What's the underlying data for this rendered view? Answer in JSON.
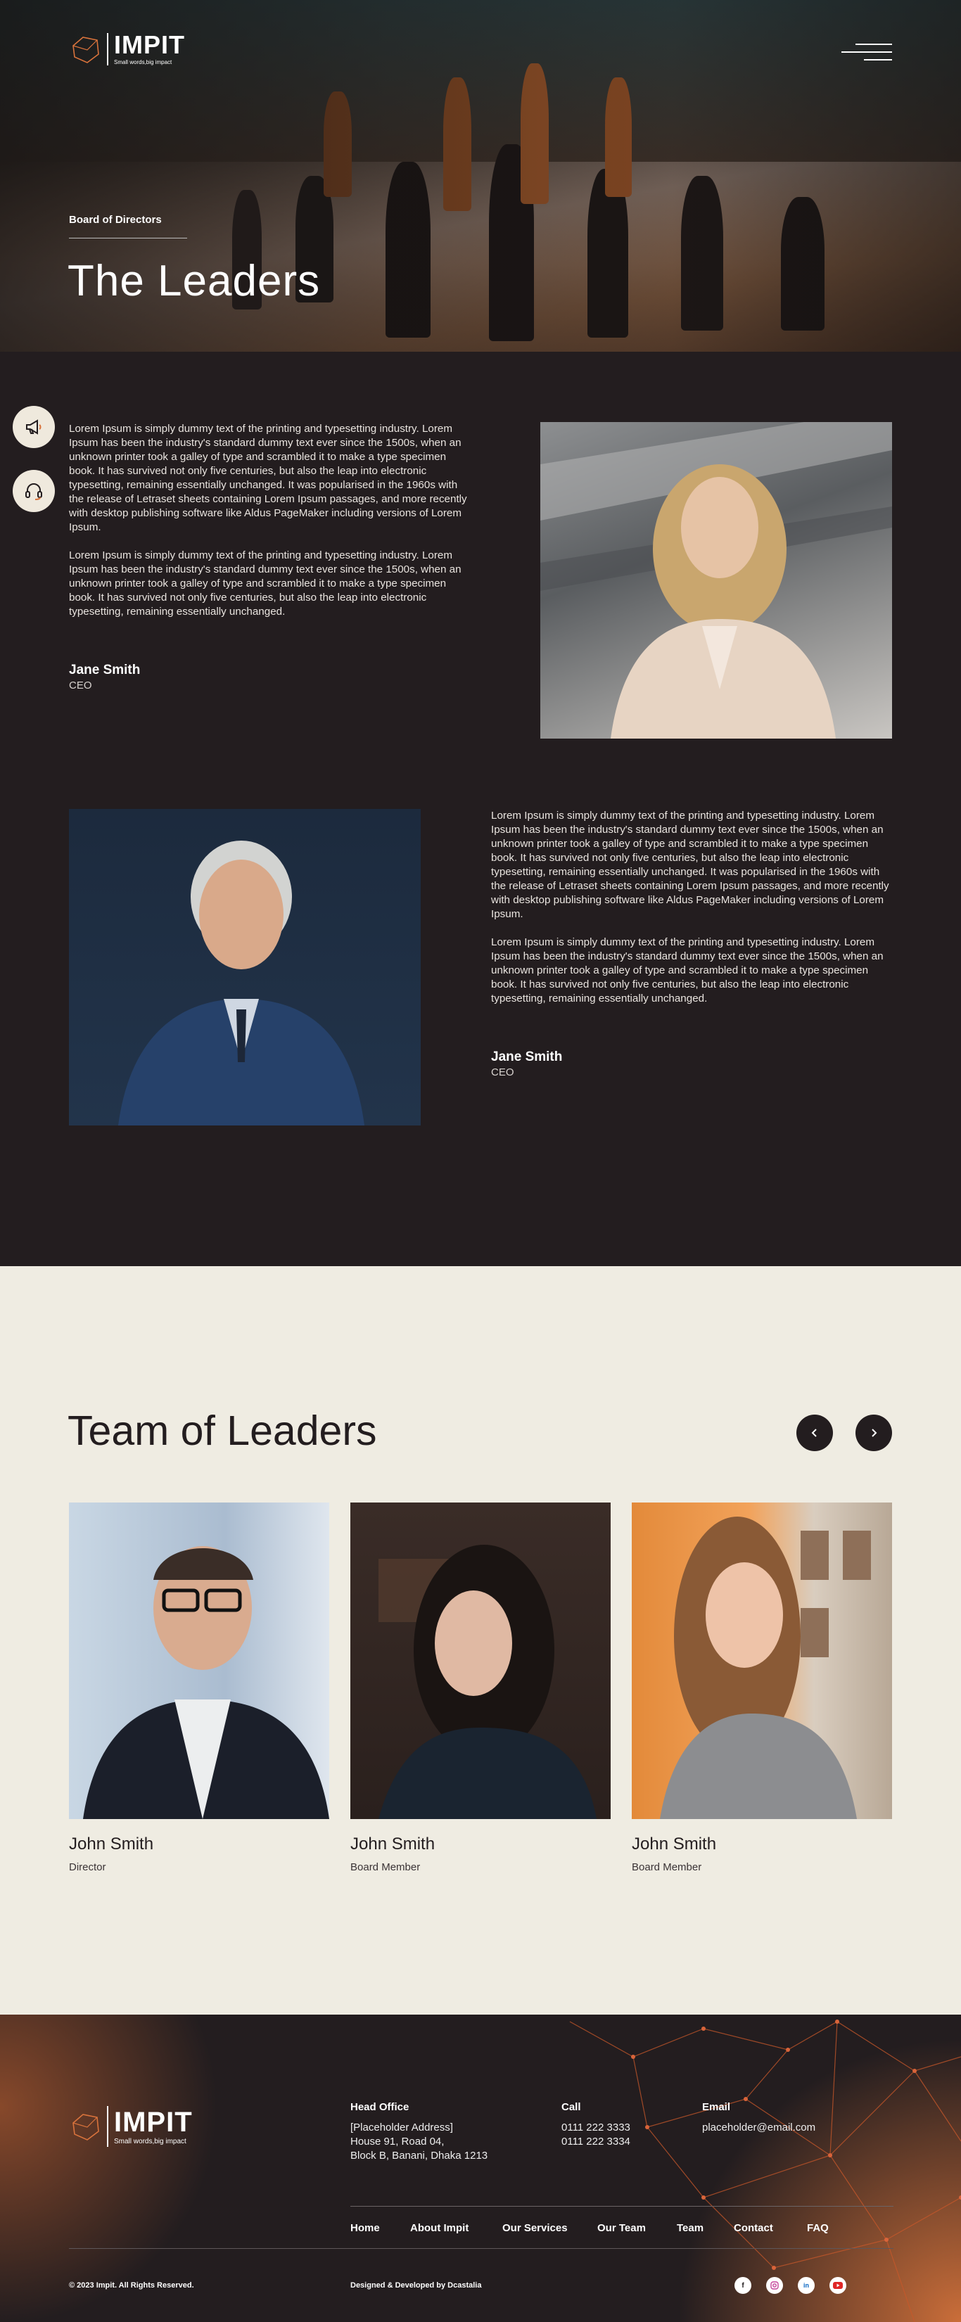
{
  "brand": {
    "name": "IMPIT",
    "tagline": "Small words,big impact"
  },
  "hero": {
    "eyebrow": "Board of Directors",
    "title": "The Leaders"
  },
  "side_icons": [
    "megaphone-icon",
    "headset-icon"
  ],
  "leaders": [
    {
      "paragraph1": "Lorem Ipsum is simply dummy text of the printing and typesetting industry. Lorem Ipsum has been the industry's standard dummy text ever since the 1500s, when an unknown printer took a galley of type and scrambled it to make a type specimen book. It has survived not only five centuries, but also the leap into electronic typesetting, remaining essentially unchanged. It was popularised in the 1960s with the release of Letraset sheets containing Lorem Ipsum passages, and more recently with desktop publishing software like Aldus PageMaker including versions of Lorem Ipsum.",
      "paragraph2": "Lorem Ipsum is simply dummy text of the printing and typesetting industry. Lorem Ipsum has been the industry's standard dummy text ever since the 1500s, when an unknown printer took a galley of type and scrambled it to make a type specimen book. It has survived not only five centuries, but also the leap into electronic typesetting, remaining essentially unchanged.",
      "name": "Jane Smith",
      "role": "CEO"
    },
    {
      "paragraph1": "Lorem Ipsum is simply dummy text of the printing and typesetting industry. Lorem Ipsum has been the industry's standard dummy text ever since the 1500s, when an unknown printer took a galley of type and scrambled it to make a type specimen book. It has survived not only five centuries, but also the leap into electronic typesetting, remaining essentially unchanged. It was popularised in the 1960s with the release of Letraset sheets containing Lorem Ipsum passages, and more recently with desktop publishing software like Aldus PageMaker including versions of Lorem Ipsum.",
      "paragraph2": "Lorem Ipsum is simply dummy text of the printing and typesetting industry. Lorem Ipsum has been the industry's standard dummy text ever since the 1500s, when an unknown printer took a galley of type and scrambled it to make a type specimen book. It has survived not only five centuries, but also the leap into electronic typesetting, remaining essentially unchanged.",
      "name": "Jane Smith",
      "role": "CEO"
    }
  ],
  "team": {
    "title": "Team of Leaders",
    "prev_icon": "chevron-left-icon",
    "next_icon": "chevron-right-icon",
    "members": [
      {
        "name": "John Smith",
        "role": "Director"
      },
      {
        "name": "John Smith",
        "role": "Board Member"
      },
      {
        "name": "John Smith",
        "role": "Board Member"
      }
    ]
  },
  "footer": {
    "head_office": {
      "label": "Head Office",
      "lines": [
        "[Placeholder Address]",
        "House 91, Road 04,",
        "Block B, Banani, Dhaka 1213"
      ]
    },
    "call": {
      "label": "Call",
      "lines": [
        "0111 222 3333",
        "0111 222 3334"
      ]
    },
    "email": {
      "label": "Email",
      "value": "placeholder@email.com"
    },
    "nav": [
      "Home",
      "About Impit",
      "Our Services",
      "Our Team",
      "Team",
      "Contact",
      "FAQ"
    ],
    "copyright": "© 2023 Impit. All Rights Reserved.",
    "credit": "Designed & Developed by Dcastalia",
    "social": [
      "facebook-icon",
      "instagram-icon",
      "linkedin-icon",
      "youtube-icon"
    ]
  },
  "colors": {
    "dark": "#231d1f",
    "cream": "#efece2",
    "accent": "#e0733c"
  }
}
